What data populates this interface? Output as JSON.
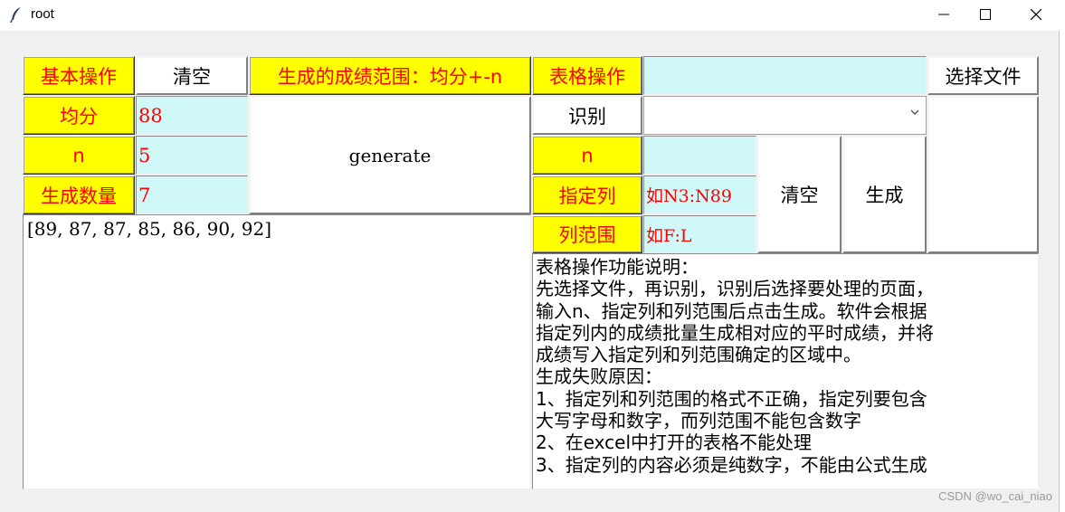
{
  "window": {
    "title": "root",
    "icon": "feather-icon",
    "controls": [
      "minimize-icon",
      "maximize-icon",
      "close-icon"
    ]
  },
  "basic": {
    "header_label": "基本操作",
    "clear_label": "清空",
    "range_label": "生成的成绩范围：均分+-n",
    "mean_label": "均分",
    "mean_value": "88",
    "n_label": "n",
    "n_value": "5",
    "count_label": "生成数量",
    "count_value": "7",
    "generate_label": "generate",
    "result_text": "[89, 87, 87, 85, 86, 90, 92]"
  },
  "table_ops": {
    "header_label": "表格操作",
    "file_value": "",
    "select_file_label": "选择文件",
    "recognize_label": "识别",
    "sheet_value": "",
    "n_label": "n",
    "n_value": "",
    "column_label": "指定列",
    "column_placeholder": "如N3:N89",
    "range_label": "列范围",
    "range_placeholder": "如F:L",
    "clear_label": "清空",
    "generate_label": "生成",
    "description_lines": [
      "表格操作功能说明：",
      "先选择文件，再识别，识别后选择要处理的页面，",
      "输入n、指定列和列范围后点击生成。软件会根据",
      "指定列内的成绩批量生成相对应的平时成绩，并将",
      "成绩写入指定列和列范围确定的区域中。",
      "生成失败原因：",
      "1、指定列和列范围的格式不正确，指定列要包含",
      "大写字母和数字，而列范围不能包含数字",
      "2、在excel中打开的表格不能处理",
      "3、指定列的内容必须是纯数字，不能由公式生成"
    ]
  },
  "watermark": "CSDN @wo_cai_niao"
}
